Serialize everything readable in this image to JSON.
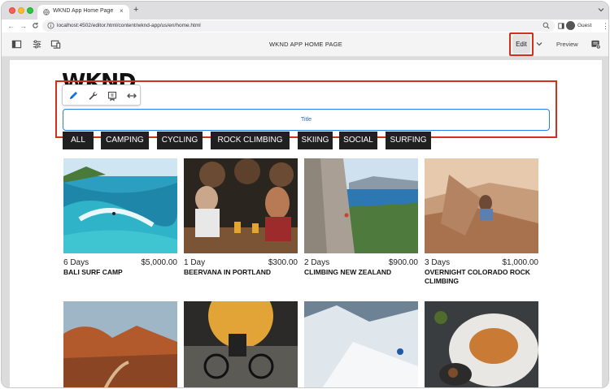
{
  "browser": {
    "tab_title": "WKND App Home Page",
    "tab_close": "×",
    "new_tab": "+",
    "back": "←",
    "forward": "→",
    "reload": "C",
    "url": "localhost:4502/editor.html/content/wknd-app/us/en/home.html",
    "profile_name": "Guest",
    "menu": "⋮"
  },
  "editor": {
    "page_name": "WKND APP HOME PAGE",
    "edit_label": "Edit",
    "preview_label": "Preview"
  },
  "page": {
    "logo": "WKND",
    "title_component_label": "Title",
    "filters": [
      "ALL",
      "CAMPING",
      "CYCLING",
      "ROCK CLIMBING",
      "SKIING",
      "SOCIAL",
      "SURFING"
    ],
    "cards": [
      {
        "days": "6 Days",
        "price": "$5,000.00",
        "title": "BALI SURF CAMP"
      },
      {
        "days": "1 Day",
        "price": "$300.00",
        "title": "BEERVANA IN PORTLAND"
      },
      {
        "days": "2 Days",
        "price": "$900.00",
        "title": "CLIMBING NEW ZEALAND"
      },
      {
        "days": "3 Days",
        "price": "$1,000.00",
        "title": "OVERNIGHT COLORADO ROCK CLIMBING"
      }
    ]
  },
  "colors": {
    "annotation_red": "#d0301c",
    "selection_blue": "#2680eb",
    "filter_bg": "#202020"
  }
}
